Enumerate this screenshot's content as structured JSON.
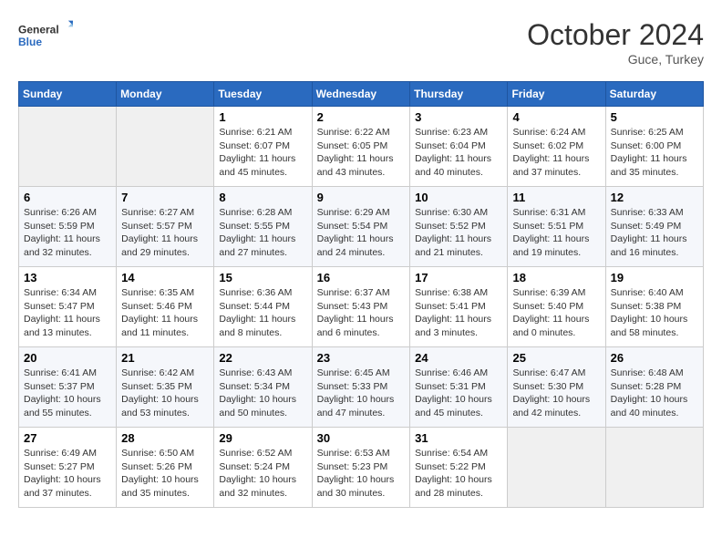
{
  "logo": {
    "text_general": "General",
    "text_blue": "Blue"
  },
  "title": "October 2024",
  "location": "Guce, Turkey",
  "days_of_week": [
    "Sunday",
    "Monday",
    "Tuesday",
    "Wednesday",
    "Thursday",
    "Friday",
    "Saturday"
  ],
  "weeks": [
    [
      {
        "day": "",
        "sunrise": "",
        "sunset": "",
        "daylight": ""
      },
      {
        "day": "",
        "sunrise": "",
        "sunset": "",
        "daylight": ""
      },
      {
        "day": "1",
        "sunrise": "Sunrise: 6:21 AM",
        "sunset": "Sunset: 6:07 PM",
        "daylight": "Daylight: 11 hours and 45 minutes."
      },
      {
        "day": "2",
        "sunrise": "Sunrise: 6:22 AM",
        "sunset": "Sunset: 6:05 PM",
        "daylight": "Daylight: 11 hours and 43 minutes."
      },
      {
        "day": "3",
        "sunrise": "Sunrise: 6:23 AM",
        "sunset": "Sunset: 6:04 PM",
        "daylight": "Daylight: 11 hours and 40 minutes."
      },
      {
        "day": "4",
        "sunrise": "Sunrise: 6:24 AM",
        "sunset": "Sunset: 6:02 PM",
        "daylight": "Daylight: 11 hours and 37 minutes."
      },
      {
        "day": "5",
        "sunrise": "Sunrise: 6:25 AM",
        "sunset": "Sunset: 6:00 PM",
        "daylight": "Daylight: 11 hours and 35 minutes."
      }
    ],
    [
      {
        "day": "6",
        "sunrise": "Sunrise: 6:26 AM",
        "sunset": "Sunset: 5:59 PM",
        "daylight": "Daylight: 11 hours and 32 minutes."
      },
      {
        "day": "7",
        "sunrise": "Sunrise: 6:27 AM",
        "sunset": "Sunset: 5:57 PM",
        "daylight": "Daylight: 11 hours and 29 minutes."
      },
      {
        "day": "8",
        "sunrise": "Sunrise: 6:28 AM",
        "sunset": "Sunset: 5:55 PM",
        "daylight": "Daylight: 11 hours and 27 minutes."
      },
      {
        "day": "9",
        "sunrise": "Sunrise: 6:29 AM",
        "sunset": "Sunset: 5:54 PM",
        "daylight": "Daylight: 11 hours and 24 minutes."
      },
      {
        "day": "10",
        "sunrise": "Sunrise: 6:30 AM",
        "sunset": "Sunset: 5:52 PM",
        "daylight": "Daylight: 11 hours and 21 minutes."
      },
      {
        "day": "11",
        "sunrise": "Sunrise: 6:31 AM",
        "sunset": "Sunset: 5:51 PM",
        "daylight": "Daylight: 11 hours and 19 minutes."
      },
      {
        "day": "12",
        "sunrise": "Sunrise: 6:33 AM",
        "sunset": "Sunset: 5:49 PM",
        "daylight": "Daylight: 11 hours and 16 minutes."
      }
    ],
    [
      {
        "day": "13",
        "sunrise": "Sunrise: 6:34 AM",
        "sunset": "Sunset: 5:47 PM",
        "daylight": "Daylight: 11 hours and 13 minutes."
      },
      {
        "day": "14",
        "sunrise": "Sunrise: 6:35 AM",
        "sunset": "Sunset: 5:46 PM",
        "daylight": "Daylight: 11 hours and 11 minutes."
      },
      {
        "day": "15",
        "sunrise": "Sunrise: 6:36 AM",
        "sunset": "Sunset: 5:44 PM",
        "daylight": "Daylight: 11 hours and 8 minutes."
      },
      {
        "day": "16",
        "sunrise": "Sunrise: 6:37 AM",
        "sunset": "Sunset: 5:43 PM",
        "daylight": "Daylight: 11 hours and 6 minutes."
      },
      {
        "day": "17",
        "sunrise": "Sunrise: 6:38 AM",
        "sunset": "Sunset: 5:41 PM",
        "daylight": "Daylight: 11 hours and 3 minutes."
      },
      {
        "day": "18",
        "sunrise": "Sunrise: 6:39 AM",
        "sunset": "Sunset: 5:40 PM",
        "daylight": "Daylight: 11 hours and 0 minutes."
      },
      {
        "day": "19",
        "sunrise": "Sunrise: 6:40 AM",
        "sunset": "Sunset: 5:38 PM",
        "daylight": "Daylight: 10 hours and 58 minutes."
      }
    ],
    [
      {
        "day": "20",
        "sunrise": "Sunrise: 6:41 AM",
        "sunset": "Sunset: 5:37 PM",
        "daylight": "Daylight: 10 hours and 55 minutes."
      },
      {
        "day": "21",
        "sunrise": "Sunrise: 6:42 AM",
        "sunset": "Sunset: 5:35 PM",
        "daylight": "Daylight: 10 hours and 53 minutes."
      },
      {
        "day": "22",
        "sunrise": "Sunrise: 6:43 AM",
        "sunset": "Sunset: 5:34 PM",
        "daylight": "Daylight: 10 hours and 50 minutes."
      },
      {
        "day": "23",
        "sunrise": "Sunrise: 6:45 AM",
        "sunset": "Sunset: 5:33 PM",
        "daylight": "Daylight: 10 hours and 47 minutes."
      },
      {
        "day": "24",
        "sunrise": "Sunrise: 6:46 AM",
        "sunset": "Sunset: 5:31 PM",
        "daylight": "Daylight: 10 hours and 45 minutes."
      },
      {
        "day": "25",
        "sunrise": "Sunrise: 6:47 AM",
        "sunset": "Sunset: 5:30 PM",
        "daylight": "Daylight: 10 hours and 42 minutes."
      },
      {
        "day": "26",
        "sunrise": "Sunrise: 6:48 AM",
        "sunset": "Sunset: 5:28 PM",
        "daylight": "Daylight: 10 hours and 40 minutes."
      }
    ],
    [
      {
        "day": "27",
        "sunrise": "Sunrise: 6:49 AM",
        "sunset": "Sunset: 5:27 PM",
        "daylight": "Daylight: 10 hours and 37 minutes."
      },
      {
        "day": "28",
        "sunrise": "Sunrise: 6:50 AM",
        "sunset": "Sunset: 5:26 PM",
        "daylight": "Daylight: 10 hours and 35 minutes."
      },
      {
        "day": "29",
        "sunrise": "Sunrise: 6:52 AM",
        "sunset": "Sunset: 5:24 PM",
        "daylight": "Daylight: 10 hours and 32 minutes."
      },
      {
        "day": "30",
        "sunrise": "Sunrise: 6:53 AM",
        "sunset": "Sunset: 5:23 PM",
        "daylight": "Daylight: 10 hours and 30 minutes."
      },
      {
        "day": "31",
        "sunrise": "Sunrise: 6:54 AM",
        "sunset": "Sunset: 5:22 PM",
        "daylight": "Daylight: 10 hours and 28 minutes."
      },
      {
        "day": "",
        "sunrise": "",
        "sunset": "",
        "daylight": ""
      },
      {
        "day": "",
        "sunrise": "",
        "sunset": "",
        "daylight": ""
      }
    ]
  ]
}
